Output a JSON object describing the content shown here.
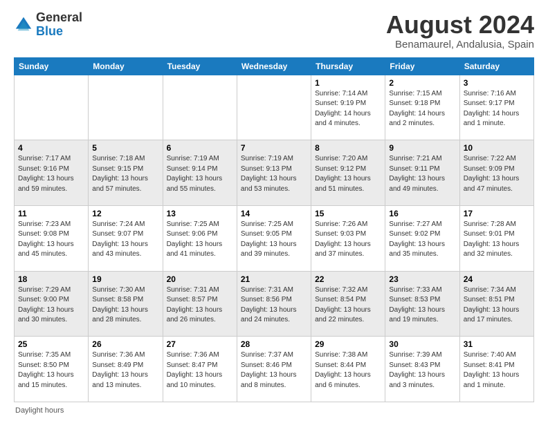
{
  "header": {
    "logo_general": "General",
    "logo_blue": "Blue",
    "month_title": "August 2024",
    "location": "Benamaurel, Andalusia, Spain"
  },
  "days_of_week": [
    "Sunday",
    "Monday",
    "Tuesday",
    "Wednesday",
    "Thursday",
    "Friday",
    "Saturday"
  ],
  "weeks": [
    [
      {
        "day": "",
        "sunrise": "",
        "sunset": "",
        "daylight": ""
      },
      {
        "day": "",
        "sunrise": "",
        "sunset": "",
        "daylight": ""
      },
      {
        "day": "",
        "sunrise": "",
        "sunset": "",
        "daylight": ""
      },
      {
        "day": "",
        "sunrise": "",
        "sunset": "",
        "daylight": ""
      },
      {
        "day": "1",
        "sunrise": "7:14 AM",
        "sunset": "9:19 PM",
        "daylight": "14 hours and 4 minutes."
      },
      {
        "day": "2",
        "sunrise": "7:15 AM",
        "sunset": "9:18 PM",
        "daylight": "14 hours and 2 minutes."
      },
      {
        "day": "3",
        "sunrise": "7:16 AM",
        "sunset": "9:17 PM",
        "daylight": "14 hours and 1 minute."
      }
    ],
    [
      {
        "day": "4",
        "sunrise": "7:17 AM",
        "sunset": "9:16 PM",
        "daylight": "13 hours and 59 minutes."
      },
      {
        "day": "5",
        "sunrise": "7:18 AM",
        "sunset": "9:15 PM",
        "daylight": "13 hours and 57 minutes."
      },
      {
        "day": "6",
        "sunrise": "7:19 AM",
        "sunset": "9:14 PM",
        "daylight": "13 hours and 55 minutes."
      },
      {
        "day": "7",
        "sunrise": "7:19 AM",
        "sunset": "9:13 PM",
        "daylight": "13 hours and 53 minutes."
      },
      {
        "day": "8",
        "sunrise": "7:20 AM",
        "sunset": "9:12 PM",
        "daylight": "13 hours and 51 minutes."
      },
      {
        "day": "9",
        "sunrise": "7:21 AM",
        "sunset": "9:11 PM",
        "daylight": "13 hours and 49 minutes."
      },
      {
        "day": "10",
        "sunrise": "7:22 AM",
        "sunset": "9:09 PM",
        "daylight": "13 hours and 47 minutes."
      }
    ],
    [
      {
        "day": "11",
        "sunrise": "7:23 AM",
        "sunset": "9:08 PM",
        "daylight": "13 hours and 45 minutes."
      },
      {
        "day": "12",
        "sunrise": "7:24 AM",
        "sunset": "9:07 PM",
        "daylight": "13 hours and 43 minutes."
      },
      {
        "day": "13",
        "sunrise": "7:25 AM",
        "sunset": "9:06 PM",
        "daylight": "13 hours and 41 minutes."
      },
      {
        "day": "14",
        "sunrise": "7:25 AM",
        "sunset": "9:05 PM",
        "daylight": "13 hours and 39 minutes."
      },
      {
        "day": "15",
        "sunrise": "7:26 AM",
        "sunset": "9:03 PM",
        "daylight": "13 hours and 37 minutes."
      },
      {
        "day": "16",
        "sunrise": "7:27 AM",
        "sunset": "9:02 PM",
        "daylight": "13 hours and 35 minutes."
      },
      {
        "day": "17",
        "sunrise": "7:28 AM",
        "sunset": "9:01 PM",
        "daylight": "13 hours and 32 minutes."
      }
    ],
    [
      {
        "day": "18",
        "sunrise": "7:29 AM",
        "sunset": "9:00 PM",
        "daylight": "13 hours and 30 minutes."
      },
      {
        "day": "19",
        "sunrise": "7:30 AM",
        "sunset": "8:58 PM",
        "daylight": "13 hours and 28 minutes."
      },
      {
        "day": "20",
        "sunrise": "7:31 AM",
        "sunset": "8:57 PM",
        "daylight": "13 hours and 26 minutes."
      },
      {
        "day": "21",
        "sunrise": "7:31 AM",
        "sunset": "8:56 PM",
        "daylight": "13 hours and 24 minutes."
      },
      {
        "day": "22",
        "sunrise": "7:32 AM",
        "sunset": "8:54 PM",
        "daylight": "13 hours and 22 minutes."
      },
      {
        "day": "23",
        "sunrise": "7:33 AM",
        "sunset": "8:53 PM",
        "daylight": "13 hours and 19 minutes."
      },
      {
        "day": "24",
        "sunrise": "7:34 AM",
        "sunset": "8:51 PM",
        "daylight": "13 hours and 17 minutes."
      }
    ],
    [
      {
        "day": "25",
        "sunrise": "7:35 AM",
        "sunset": "8:50 PM",
        "daylight": "13 hours and 15 minutes."
      },
      {
        "day": "26",
        "sunrise": "7:36 AM",
        "sunset": "8:49 PM",
        "daylight": "13 hours and 13 minutes."
      },
      {
        "day": "27",
        "sunrise": "7:36 AM",
        "sunset": "8:47 PM",
        "daylight": "13 hours and 10 minutes."
      },
      {
        "day": "28",
        "sunrise": "7:37 AM",
        "sunset": "8:46 PM",
        "daylight": "13 hours and 8 minutes."
      },
      {
        "day": "29",
        "sunrise": "7:38 AM",
        "sunset": "8:44 PM",
        "daylight": "13 hours and 6 minutes."
      },
      {
        "day": "30",
        "sunrise": "7:39 AM",
        "sunset": "8:43 PM",
        "daylight": "13 hours and 3 minutes."
      },
      {
        "day": "31",
        "sunrise": "7:40 AM",
        "sunset": "8:41 PM",
        "daylight": "13 hours and 1 minute."
      }
    ]
  ],
  "footer": {
    "daylight_label": "Daylight hours"
  }
}
